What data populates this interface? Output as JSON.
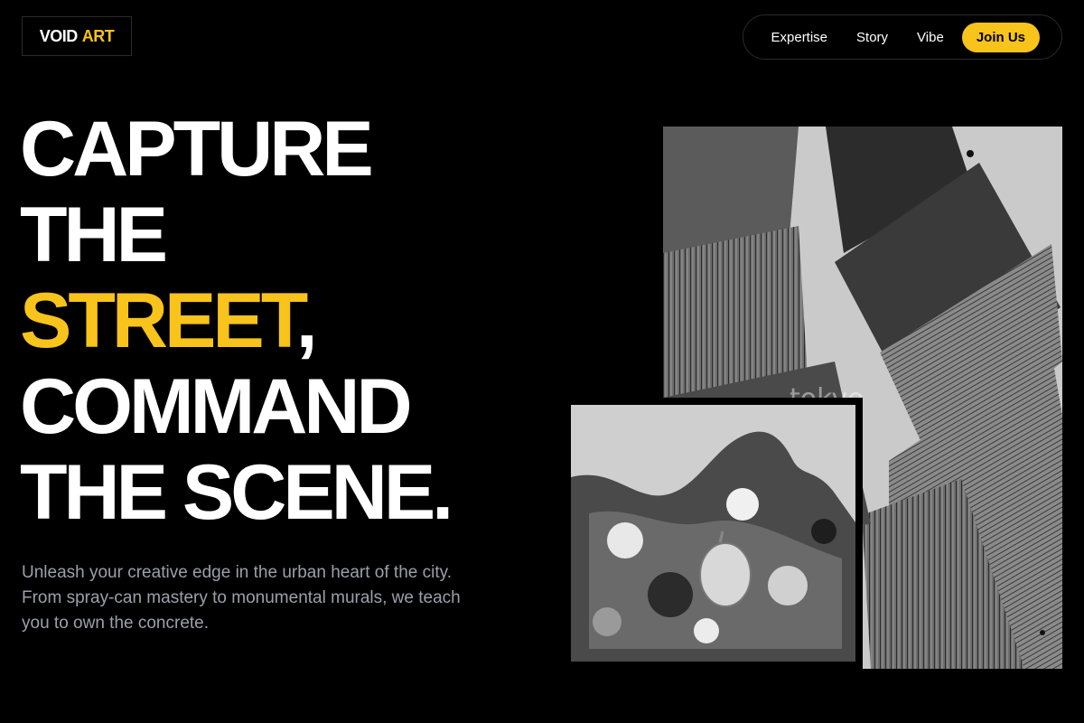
{
  "logo": {
    "primary": "VOID",
    "accent": "ART"
  },
  "nav": {
    "items": [
      "Expertise",
      "Story",
      "Vibe"
    ],
    "cta": "Join Us"
  },
  "hero": {
    "line1": "CAPTURE",
    "line2": "THE",
    "line3_highlight": "STREET",
    "line3_suffix": ",",
    "line4": "COMMAND",
    "line5": "THE SCENE.",
    "lead": "Unleash your creative edge in the urban heart of the city. From spray-can mastery to monumental murals, we teach you to own the concrete."
  },
  "images": {
    "brushes_watermark": "tokyo"
  },
  "colors": {
    "accent": "#f8c31b",
    "background": "#000000",
    "muted": "#9aa0aa"
  }
}
